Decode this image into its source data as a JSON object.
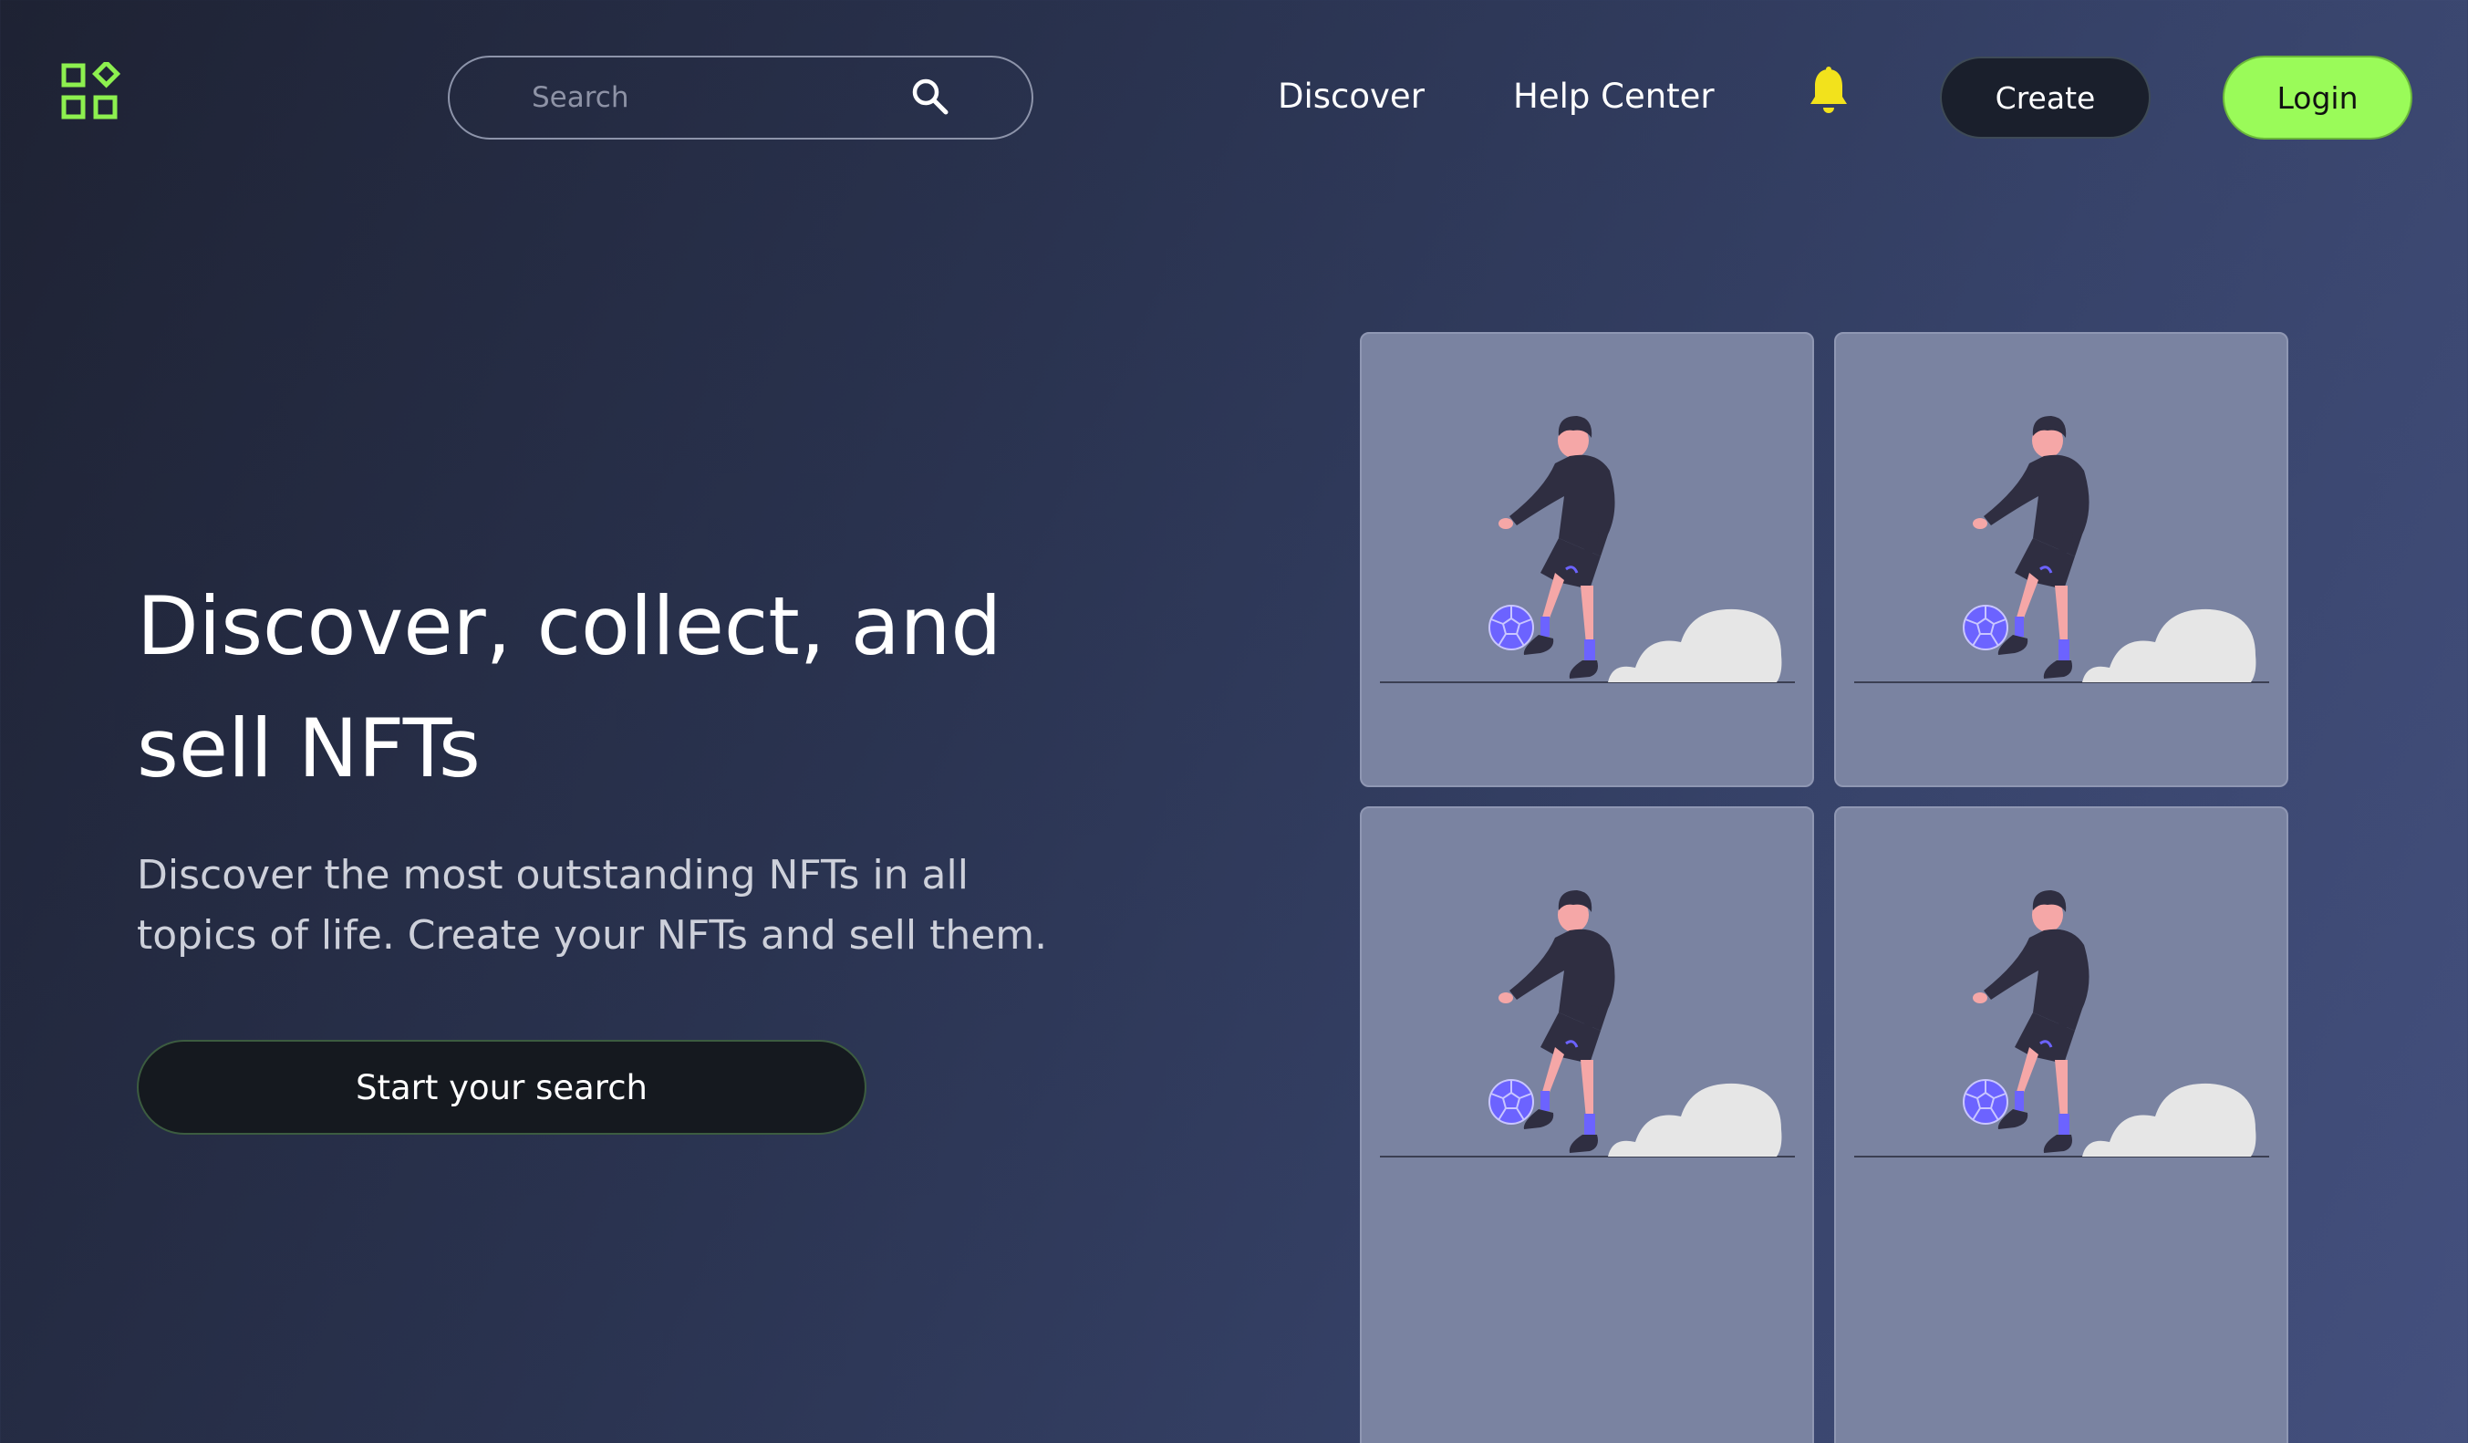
{
  "header": {
    "logo_icon": "apps-grid-icon",
    "search": {
      "placeholder": "Search",
      "value": "",
      "icon": "search-icon"
    },
    "nav": [
      {
        "label": "Discover"
      },
      {
        "label": "Help Center"
      }
    ],
    "notification_icon": "bell-icon",
    "create_label": "Create",
    "login_label": "Login"
  },
  "hero": {
    "title": "Discover, collect, and sell NFTs",
    "subtitle": "Discover the most outstanding NFTs in all topics of life. Create your NFTs and sell them.",
    "cta_label": "Start your search"
  },
  "nft_grid": {
    "items": [
      {
        "illustration": "soccer-player-illustration"
      },
      {
        "illustration": "soccer-player-illustration"
      },
      {
        "illustration": "soccer-player-illustration"
      },
      {
        "illustration": "soccer-player-illustration"
      }
    ]
  },
  "colors": {
    "accent_green": "#9afb59",
    "bell_yellow": "#f2e21c",
    "card_bg": "#7a83a1",
    "ball_purple": "#6c63ff"
  }
}
